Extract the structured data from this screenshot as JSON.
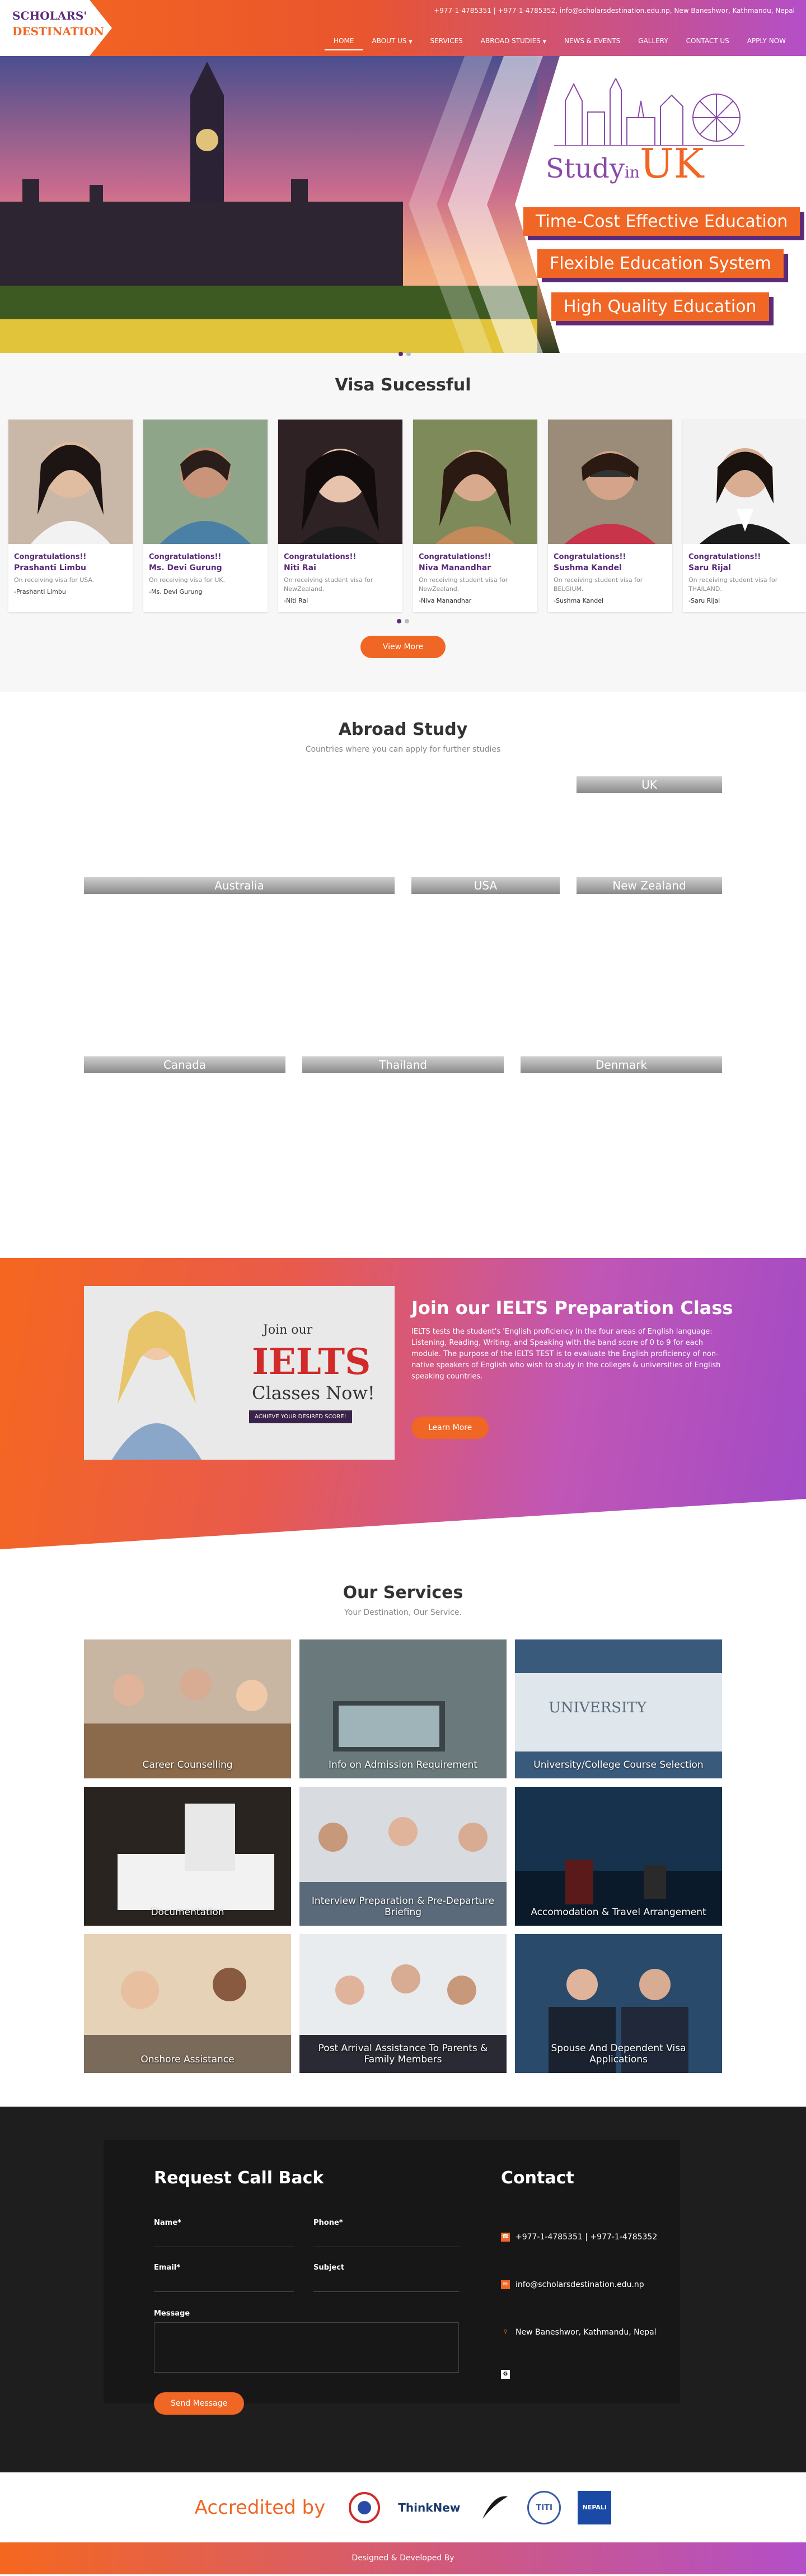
{
  "brand": {
    "logo_line1": "SCHOLARS'",
    "logo_line2": "DESTINATION"
  },
  "topbar": {
    "info": "+977-1-4785351 | +977-1-4785352, info@scholarsdestination.edu.np, New Baneshwor, Kathmandu, Nepal"
  },
  "nav": {
    "items": [
      "HOME",
      "ABOUT US",
      "SERVICES",
      "ABROAD STUDIES",
      "NEWS & EVENTS",
      "GALLERY",
      "CONTACT US",
      "APPLY NOW"
    ]
  },
  "hero": {
    "study": "Study",
    "in": "in",
    "country": "UK",
    "tags": [
      "Time-Cost Effective Education",
      "Flexible Education System",
      "High Quality Education"
    ]
  },
  "visa": {
    "title": "Visa Sucessful",
    "cards": [
      {
        "congrats": "Congratulations!!",
        "name": "Prashanti Limbu",
        "desc": "On receiving visa for USA.",
        "sign": "-Prashanti Limbu"
      },
      {
        "congrats": "Congratulations!!",
        "name": "Ms. Devi Gurung",
        "desc": "On receiving visa for UK.",
        "sign": "-Ms. Devi Gurung"
      },
      {
        "congrats": "Congratulations!!",
        "name": "Niti Rai",
        "desc": "On receiving student visa for NewZealand.",
        "sign": "-Niti Rai"
      },
      {
        "congrats": "Congratulations!!",
        "name": "Niva Manandhar",
        "desc": "On receiving student visa for NewZealand.",
        "sign": "-Niva Manandhar"
      },
      {
        "congrats": "Congratulations!!",
        "name": "Sushma Kandel",
        "desc": "On receiving student visa for BELGIUM.",
        "sign": "-Sushma Kandel"
      },
      {
        "congrats": "Congratulations!!",
        "name": "Saru Rijal",
        "desc": "On receiving student visa for THAILAND.",
        "sign": "-Saru Rijal"
      }
    ],
    "view_more": "View More"
  },
  "abroad": {
    "title": "Abroad Study",
    "subtitle": "Countries where you can apply for further studies",
    "countries": [
      "UK",
      "Australia",
      "USA",
      "New Zealand",
      "Canada",
      "Thailand",
      "Denmark"
    ]
  },
  "ielts": {
    "title": "Join our IELTS Preparation Class",
    "text": "IELTS tests the student's 'English proficiency in the four areas of English language: Listening, Reading, Writing, and Speaking with the band score of 0 to 9 for each module. The purpose of the IELTS TEST is to evaluate the English proficiency of non-native speakers of English who wish to study in the colleges & universities of English speaking countries.",
    "button": "Learn More",
    "img_join": "Join our",
    "img_big": "IELTS",
    "img_classes": "Classes Now!",
    "img_achieve": "ACHIEVE YOUR DESIRED SCORE!"
  },
  "services": {
    "title": "Our Services",
    "subtitle": "Your Destination, Our Service.",
    "items": [
      "Career Counselling",
      "Info on Admission Requirement",
      "University/College Course Selection",
      "Documentation",
      "Interview Preparation & Pre-Departure Briefing",
      "Accomodation & Travel Arrangement",
      "Onshore Assistance",
      "Post Arrival Assistance To Parents & Family Members",
      "Spouse And Dependent Visa Applications"
    ]
  },
  "contact": {
    "form_title": "Request Call Back",
    "name_label": "Name*",
    "phone_label": "Phone*",
    "email_label": "Email*",
    "subject_label": "Subject",
    "message_label": "Message",
    "send": "Send Message",
    "info_title": "Contact",
    "phone": "+977-1-4785351 | +977-1-4785352",
    "email": "info@scholarsdestination.edu.np",
    "address": "New Baneshwor, Kathmandu, Nepal"
  },
  "accredited": {
    "title": "Accredited by",
    "logos": [
      "ThinkNew",
      "TITI",
      "NEPALI"
    ]
  },
  "footer": {
    "text": "Designed & Developed By"
  },
  "colors": {
    "orange": "#f06624",
    "purple": "#5b2b7a",
    "gradient_end": "#b34fc8"
  }
}
